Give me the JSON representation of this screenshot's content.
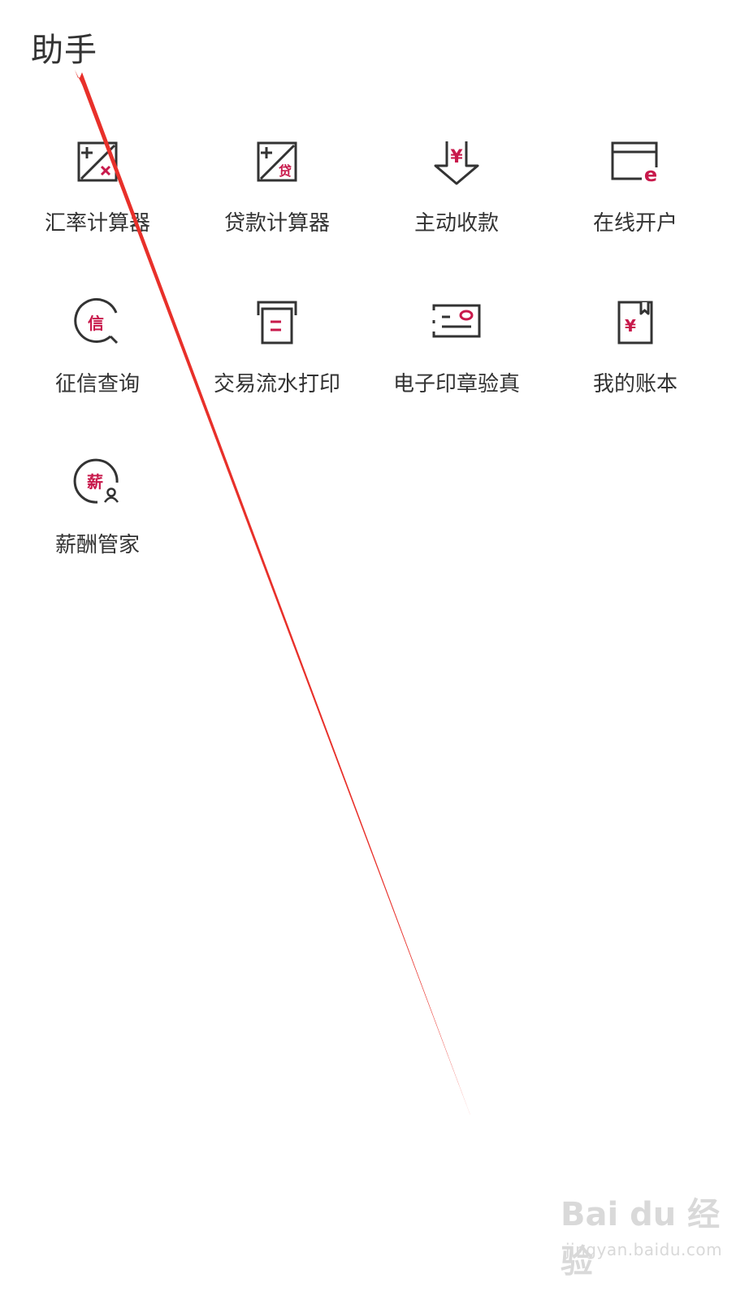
{
  "header": {
    "title": "助手"
  },
  "services": [
    {
      "label": "汇率计算器",
      "icon": "exchange-calculator-icon"
    },
    {
      "label": "贷款计算器",
      "icon": "loan-calculator-icon",
      "glyph": "贷"
    },
    {
      "label": "主动收款",
      "icon": "collect-payment-icon",
      "glyph": "¥"
    },
    {
      "label": "在线开户",
      "icon": "online-account-icon",
      "glyph": "e"
    },
    {
      "label": "征信查询",
      "icon": "credit-query-icon",
      "glyph": "信"
    },
    {
      "label": "交易流水打印",
      "icon": "transaction-print-icon"
    },
    {
      "label": "电子印章验真",
      "icon": "seal-verify-icon"
    },
    {
      "label": "我的账本",
      "icon": "ledger-icon",
      "glyph": "¥"
    },
    {
      "label": "薪酬管家",
      "icon": "salary-manager-icon",
      "glyph": "薪"
    }
  ],
  "watermark": {
    "logo": "Bai du 经验",
    "url": "jingyan.baidu.com"
  },
  "colors": {
    "icon_stroke": "#333333",
    "accent": "#c8194b",
    "annotation": "#e8302a",
    "text": "#333333"
  }
}
